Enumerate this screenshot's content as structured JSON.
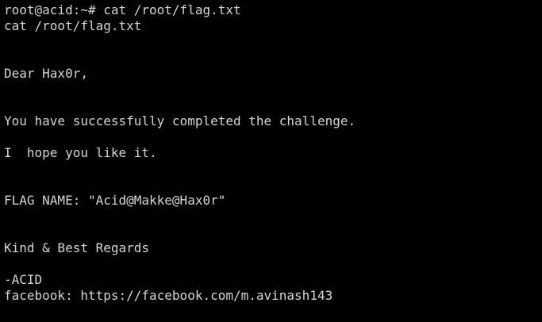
{
  "terminal": {
    "prompt": "root@acid:~# cat /root/flag.txt",
    "echo": "cat /root/flag.txt",
    "greeting": "Dear Hax0r,",
    "message1": "You have successfully completed the challenge.",
    "message2": "I  hope you like it.",
    "flag_line": "FLAG NAME: \"Acid@Makke@Hax0r\"",
    "closing": "Kind & Best Regards",
    "signature": "-ACID",
    "contact": "facebook: https://facebook.com/m.avinash143"
  },
  "colors": {
    "background": "#000000",
    "text": "#d4d4d4"
  }
}
